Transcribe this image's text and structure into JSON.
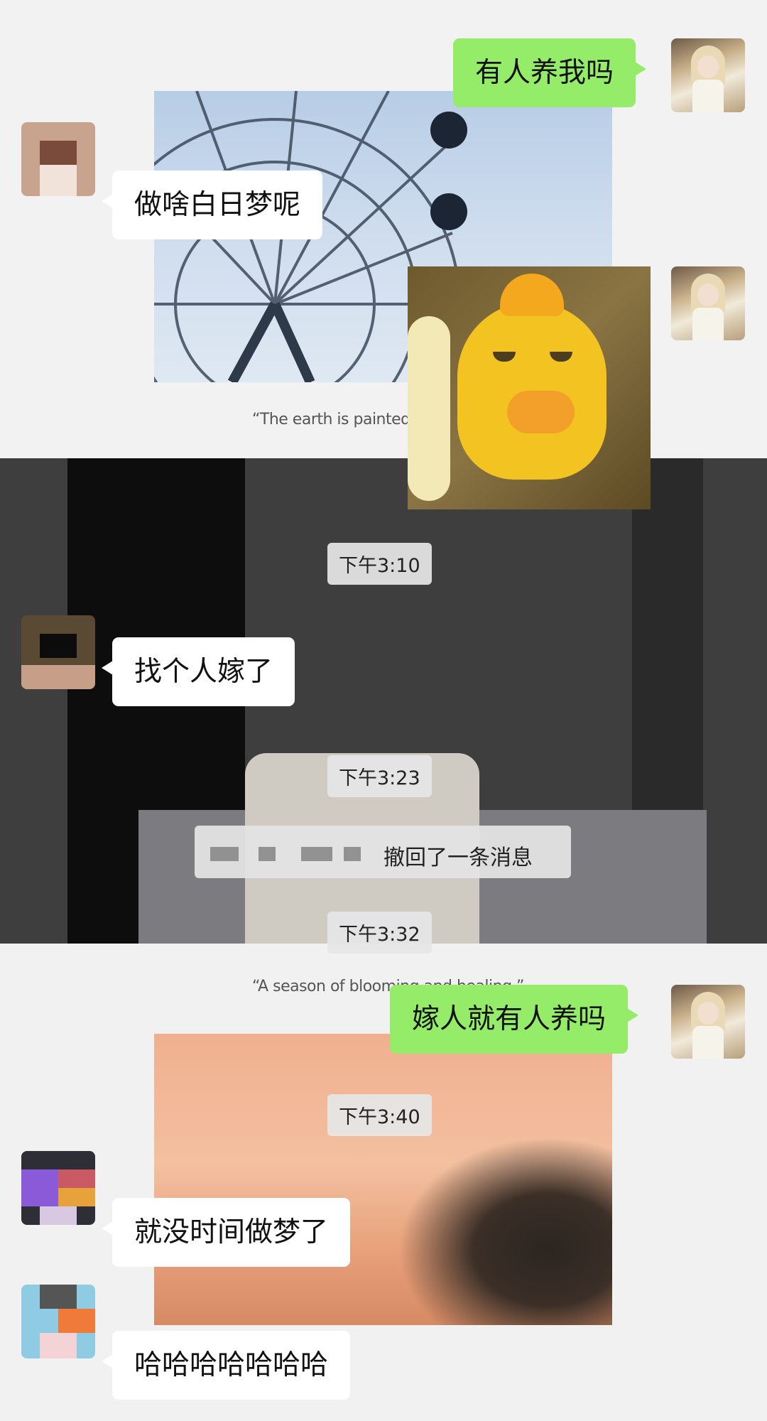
{
  "chat": {
    "messages": [
      {
        "type": "text",
        "side": "right",
        "text": "有人养我吗"
      },
      {
        "type": "text",
        "side": "left",
        "text": "做啥白日梦呢"
      },
      {
        "type": "sticker",
        "side": "right",
        "sticker": "grumpy-yellow-duck"
      },
      {
        "type": "time",
        "text": "下午3:10"
      },
      {
        "type": "text",
        "side": "left",
        "text": "找个人嫁了"
      },
      {
        "type": "time",
        "text": "下午3:23"
      },
      {
        "type": "system",
        "text": "撤回了一条消息"
      },
      {
        "type": "time",
        "text": "下午3:32"
      },
      {
        "type": "text",
        "side": "right",
        "text": "嫁人就有人养吗"
      },
      {
        "type": "time",
        "text": "下午3:40"
      },
      {
        "type": "text",
        "side": "left",
        "text": "就没时间做梦了"
      },
      {
        "type": "text",
        "side": "left",
        "text": "哈哈哈哈哈哈哈"
      }
    ]
  },
  "background": {
    "quote_top": "“The earth is painted",
    "quote_bottom": "“A season of blooming and healing.”"
  },
  "colors": {
    "self_bubble": "#95ec69",
    "other_bubble": "#ffffff",
    "timestamp_bg": "#e6e6e6"
  }
}
